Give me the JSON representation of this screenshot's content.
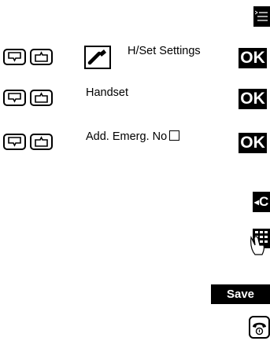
{
  "menu_key": {
    "icon": "menu-lines-icon"
  },
  "rows": [
    {
      "label": "H/Set Settings",
      "icon": "wrench-icon",
      "action": "OK"
    },
    {
      "label": "Handset",
      "action": "OK"
    },
    {
      "label": "Add. Emerg. No",
      "checkbox": "unchecked",
      "action": "OK"
    }
  ],
  "nav_keys": {
    "down": "nav-down-icon",
    "up": "nav-up-icon"
  },
  "clear_key": {
    "label": "C",
    "icon": "backspace-arrow-icon"
  },
  "keypad": {
    "icon": "keypad-hand-icon"
  },
  "save_button": {
    "label": "Save"
  },
  "end_call_key": {
    "icon": "on-hook-phone-icon"
  }
}
